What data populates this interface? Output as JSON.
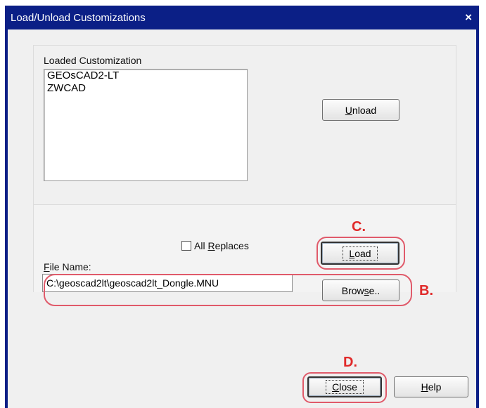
{
  "window": {
    "title": "Load/Unload Customizations",
    "close_glyph": "×",
    "frame_color": "#0b1f86"
  },
  "loaded": {
    "label": "Loaded Customization",
    "items": [
      "GEOsCAD2-LT",
      "ZWCAD"
    ]
  },
  "buttons": {
    "unload_mnemonic": "U",
    "unload_rest": "nload",
    "load_mnemonic": "L",
    "load_rest": "oad",
    "browse_pre": "Brow",
    "browse_mnemonic": "s",
    "browse_post": "e..",
    "close_mnemonic": "C",
    "close_rest": "lose",
    "help_mnemonic": "H",
    "help_rest": "elp"
  },
  "all_replaces": {
    "pre": "All ",
    "mnemonic": "R",
    "post": "eplaces",
    "checked": false
  },
  "file": {
    "label_mnemonic": "F",
    "label_rest": "ile Name:",
    "value": "C:\\geoscad2lt\\geoscad2lt_Dongle.MNU"
  },
  "annotations": {
    "c": "C.",
    "b": "B.",
    "d": "D.",
    "color": "#e02a2a"
  }
}
